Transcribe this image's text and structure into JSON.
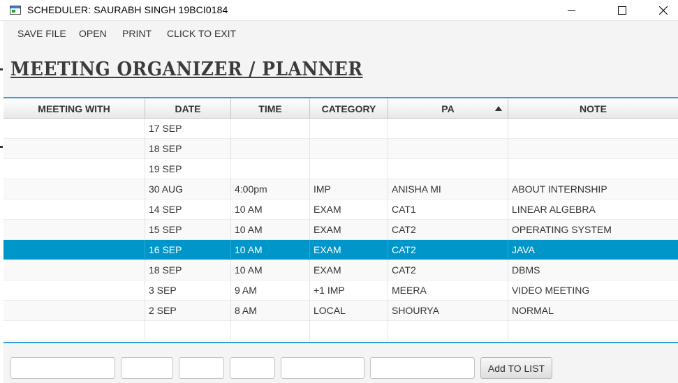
{
  "window": {
    "title": "SCHEDULER: SAURABH SINGH 19BCI0184"
  },
  "menu": {
    "items": [
      "SAVE FILE",
      "OPEN",
      "PRINT",
      "CLICK TO EXIT"
    ]
  },
  "heading": "Meeting Organizer / Planner",
  "table": {
    "columns": [
      "MEETING WITH",
      "DATE",
      "TIME",
      "CATEGORY",
      "PA",
      "NOTE"
    ],
    "sorted_column": "PA",
    "sort_direction": "ascending",
    "selected_row_index": 6,
    "rows": [
      [
        "",
        "17 SEP",
        "",
        "",
        "",
        ""
      ],
      [
        "",
        "18 SEP",
        "",
        "",
        "",
        ""
      ],
      [
        "",
        "19 SEP",
        "",
        "",
        "",
        ""
      ],
      [
        "",
        "30 AUG",
        "4:00pm",
        "IMP",
        "ANISHA MI",
        "ABOUT INTERNSHIP"
      ],
      [
        "",
        "14 SEP",
        "10 AM",
        "EXAM",
        "CAT1",
        "LINEAR ALGEBRA"
      ],
      [
        "",
        "15 SEP",
        "10 AM",
        "EXAM",
        "CAT2",
        "OPERATING SYSTEM"
      ],
      [
        "",
        "16 SEP",
        "10 AM",
        "EXAM",
        "CAT2",
        "JAVA"
      ],
      [
        "",
        "18 SEP",
        "10 AM",
        "EXAM",
        "CAT2",
        "DBMS"
      ],
      [
        "",
        "3 SEP",
        "9 AM",
        "+1 IMP",
        "MEERA",
        "VIDEO MEETING"
      ],
      [
        "",
        "2 SEP",
        "8 AM",
        "LOCAL",
        "SHOURYA",
        "NORMAL"
      ],
      [
        "",
        "",
        "",
        "",
        "",
        ""
      ]
    ]
  },
  "form": {
    "fields": [
      {
        "name": "meeting-with-input",
        "value": ""
      },
      {
        "name": "date-input",
        "value": ""
      },
      {
        "name": "time-input",
        "value": ""
      },
      {
        "name": "category-input",
        "value": ""
      },
      {
        "name": "pa-input",
        "value": ""
      },
      {
        "name": "note-input",
        "value": ""
      }
    ],
    "add_button_label": "Add TO LIST"
  },
  "colors": {
    "selection": "#0096c9",
    "table_border": "#2f9ed8"
  },
  "icons": {
    "app": "app-window-icon",
    "minimize": "minimize-icon",
    "maximize": "maximize-icon",
    "close": "close-icon",
    "sort": "sort-ascending-icon"
  }
}
